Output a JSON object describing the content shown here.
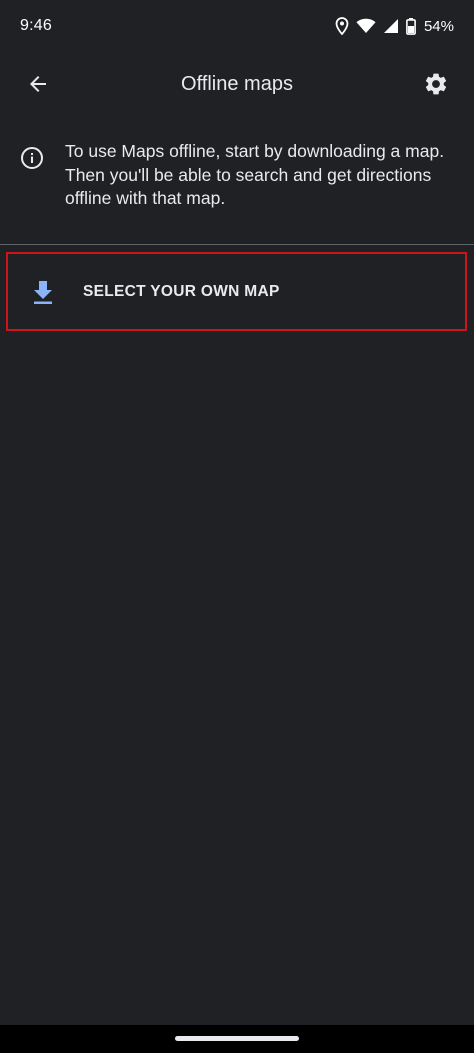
{
  "status_bar": {
    "time": "9:46",
    "battery_percent": "54%",
    "icons": [
      "location-icon",
      "wifi-icon",
      "signal-icon",
      "battery-icon"
    ]
  },
  "app_bar": {
    "title": "Offline maps",
    "back_icon": "arrow-back-icon",
    "settings_icon": "gear-icon"
  },
  "info": {
    "icon": "info-icon",
    "text": "To use Maps offline, start by downloading a map. Then you'll be able to search and get directions offline with that map."
  },
  "actions": {
    "select_map": {
      "icon": "download-icon",
      "label": "SELECT YOUR OWN MAP"
    }
  },
  "colors": {
    "background": "#202124",
    "text": "#e8eaed",
    "accent_blue": "#8ab4f8",
    "highlight_border": "#d0121a",
    "divider": "#5f6368"
  }
}
